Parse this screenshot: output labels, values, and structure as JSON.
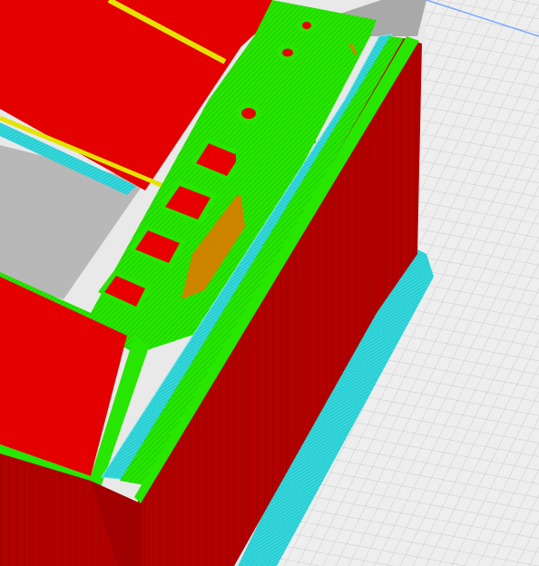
{
  "app": {
    "view": "slicer-3d-preview",
    "mode": "layer-view"
  },
  "colors": {
    "build_plate": "#eeeeee",
    "grid_line": "#c8c8c8",
    "grid_line_major": "#b8b8b8",
    "outer_wall": "#dd0000",
    "outer_wall_shadow": "#9a0000",
    "inner_wall": "#22ee00",
    "infill": "#ff2a2a",
    "support": "#33dddd",
    "skin": "#ffff00",
    "overhang": "#e08000",
    "plate_edge": "#7aa7ff",
    "shadow": "#a8a8a8"
  },
  "legend_features": [
    "outer-wall",
    "inner-wall",
    "infill",
    "support",
    "skin",
    "overhang"
  ]
}
